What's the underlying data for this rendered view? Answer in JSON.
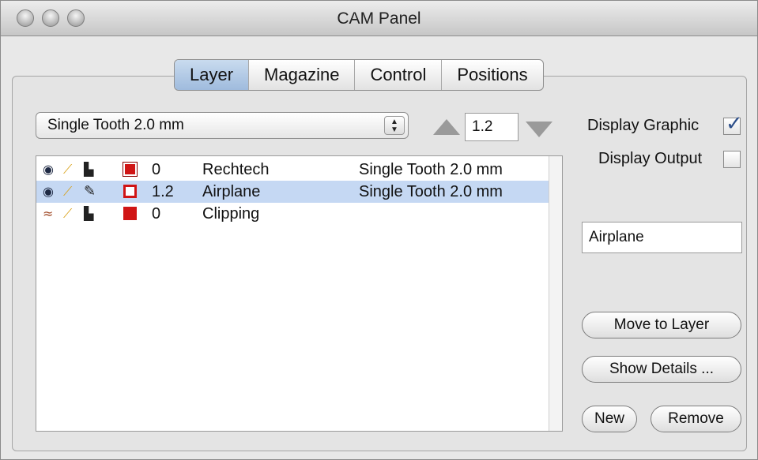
{
  "window": {
    "title": "CAM Panel"
  },
  "tabs": [
    {
      "label": "Layer",
      "active": true
    },
    {
      "label": "Magazine",
      "active": false
    },
    {
      "label": "Control",
      "active": false
    },
    {
      "label": "Positions",
      "active": false
    }
  ],
  "tool_popup": {
    "value": "Single Tooth 2.0 mm"
  },
  "stepper": {
    "value": "1.2"
  },
  "display_graphic": {
    "label": "Display Graphic",
    "checked": true
  },
  "display_output": {
    "label": "Display Output",
    "checked": false
  },
  "layers": [
    {
      "depth": "0",
      "name": "Rechtech",
      "tool": "Single Tooth 2.0 mm",
      "visible": true,
      "selected": false,
      "icons": [
        "eye-icon",
        "wrench-icon",
        "door-icon",
        "red-square-icon"
      ]
    },
    {
      "depth": "1.2",
      "name": "Airplane",
      "tool": "Single Tooth 2.0 mm",
      "visible": true,
      "selected": true,
      "icons": [
        "eye-icon",
        "wrench-icon",
        "pen-icon",
        "red-square-icon"
      ]
    },
    {
      "depth": "0",
      "name": "Clipping",
      "tool": "",
      "visible": false,
      "selected": false,
      "icons": [
        "closed-eye-icon",
        "wrench-icon",
        "door-icon",
        "red-square-icon"
      ]
    }
  ],
  "layer_name_field": {
    "value": "Airplane"
  },
  "buttons": {
    "move_to_layer": "Move to Layer",
    "show_details": "Show Details ...",
    "new": "New",
    "remove": "Remove"
  },
  "colors": {
    "selection": "#c5d8f3",
    "active_tab": "#aec6e6",
    "layer_color": "#d01515"
  }
}
